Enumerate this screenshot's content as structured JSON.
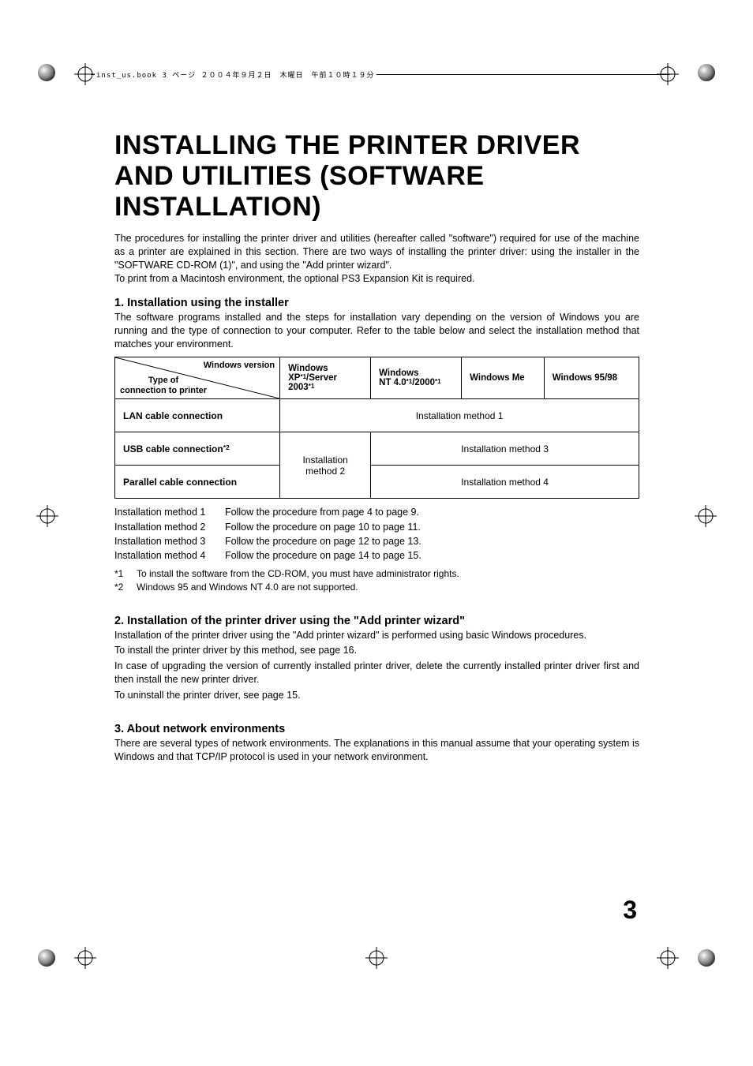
{
  "header_text": "inst_us.book 3 ページ ２００４年９月２日　木曜日　午前１０時１９分",
  "title": "INSTALLING THE PRINTER DRIVER AND UTILITIES (SOFTWARE INSTALLATION)",
  "intro_p1": "The procedures for installing the printer driver and utilities (hereafter called \"software\") required for use of the machine as a printer are explained in this section. There are two ways of installing the printer driver: using the installer in the \"SOFTWARE CD-ROM (1)\", and using the \"Add printer wizard\".",
  "intro_p2": "To print from a Macintosh environment, the optional PS3 Expansion Kit is required.",
  "sec1_head": "1.  Installation using the installer",
  "sec1_body": "The software programs installed and the steps for installation vary depending on the version of Windows you are running and the type of connection to your computer. Refer to the table below and select the installation method that matches your environment.",
  "table": {
    "diag_top": "Windows version",
    "diag_bot": "Type of\nconnection to printer",
    "cols": {
      "c1a": "Windows",
      "c1b": "XP",
      "c1c": "/Server 2003",
      "c2a": "Windows",
      "c2b": "NT 4.0",
      "c2c": "/2000",
      "c3": "Windows Me",
      "c4": "Windows 95/98"
    },
    "rows": {
      "r1": "LAN cable connection",
      "r2": "USB cable connection",
      "r3": "Parallel cable connection"
    },
    "cells": {
      "m1": "Installation method 1",
      "m2": "Installation\nmethod 2",
      "m3": "Installation method 3",
      "m4": "Installation method 4"
    },
    "sup1": "*1",
    "sup2": "*2"
  },
  "methods": {
    "r1l": "Installation method 1",
    "r1t": "Follow the procedure from page 4 to page 9.",
    "r2l": "Installation method 2",
    "r2t": "Follow the procedure on page 10 to page 11.",
    "r3l": "Installation method 3",
    "r3t": "Follow the procedure on page 12 to page 13.",
    "r4l": "Installation method 4",
    "r4t": "Follow the procedure on page 14 to page 15."
  },
  "footnotes": {
    "f1n": "*1",
    "f1t": "To install the software from the CD-ROM, you must have administrator rights.",
    "f2n": "*2",
    "f2t": "Windows 95 and Windows NT 4.0 are not supported."
  },
  "sec2_head": "2.  Installation of the printer driver using the \"Add printer wizard\"",
  "sec2_p1": "Installation of the printer driver using the \"Add printer wizard\" is performed using basic Windows procedures.",
  "sec2_p2": "To install the printer driver by this method, see page 16.",
  "sec2_p3": "In case of upgrading the version of currently installed printer driver, delete the currently installed printer driver first and then install the new printer driver.",
  "sec2_p4": "To uninstall the printer driver, see page 15.",
  "sec3_head": "3.  About network environments",
  "sec3_body": "There are several types of network environments. The explanations in this manual assume that your operating system is Windows and that TCP/IP protocol is used in your network environment.",
  "page_number": "3"
}
